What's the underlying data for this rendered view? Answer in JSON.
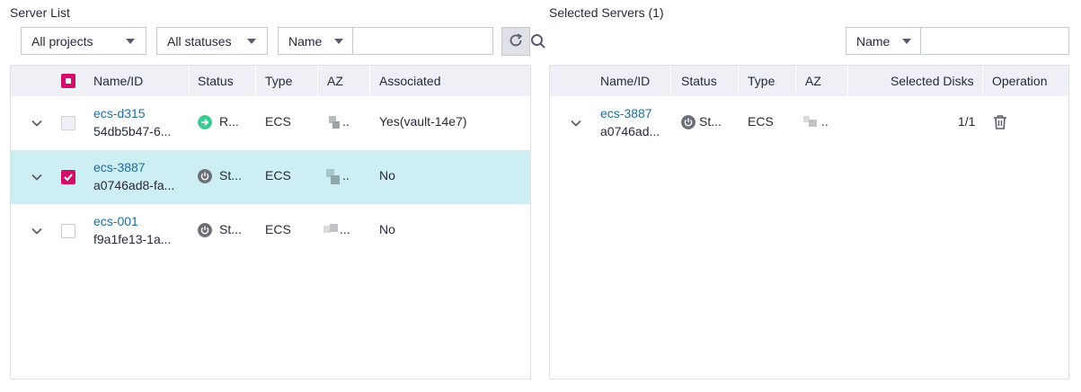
{
  "left": {
    "title": "Server List",
    "project_filter": "All projects",
    "status_filter": "All statuses",
    "search_attr": "Name",
    "search_value": "",
    "columns": {
      "name": "Name/ID",
      "status": "Status",
      "type": "Type",
      "az": "AZ",
      "associated": "Associated"
    },
    "rows": [
      {
        "name": "ecs-d315",
        "id": "54db5b47-6...",
        "status": "R...",
        "type": "ECS",
        "az": "..",
        "associated": "Yes(vault-14e7)"
      },
      {
        "name": "ecs-3887",
        "id": "a0746ad8-fa...",
        "status": "St...",
        "type": "ECS",
        "az": "..",
        "associated": "No"
      },
      {
        "name": "ecs-001",
        "id": "f9a1fe13-1a...",
        "status": "St...",
        "type": "ECS",
        "az": "...",
        "associated": "No"
      }
    ]
  },
  "right": {
    "title": "Selected Servers (1)",
    "search_attr": "Name",
    "search_value": "",
    "columns": {
      "name": "Name/ID",
      "status": "Status",
      "type": "Type",
      "az": "AZ",
      "disks": "Selected Disks",
      "operation": "Operation"
    },
    "rows": [
      {
        "name": "ecs-3887",
        "id": "a0746ad...",
        "status": "St...",
        "type": "ECS",
        "az": "..",
        "disks": "1/1"
      }
    ]
  },
  "colors": {
    "accent": "#d10f6a",
    "link": "#1e6c9c",
    "running": "#3ecb93",
    "stopped": "#6c6f78",
    "selected_row": "#cdeef2",
    "header_bg": "#eef0f5"
  }
}
